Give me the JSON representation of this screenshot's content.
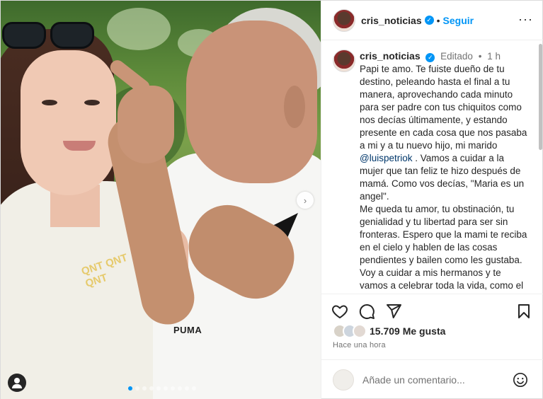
{
  "header": {
    "username": "cris_noticias",
    "separator": "•",
    "follow_label": "Seguir",
    "more_icon": "more-horizontal-icon"
  },
  "caption": {
    "username": "cris_noticias",
    "edited_label": "Editado",
    "separator": "•",
    "time": "1 h",
    "text_1": "Papi te amo. Te fuiste dueño de tu destino, peleando hasta el final a tu manera, aprovechando cada minuto para ser padre con tus chiquitos como nos decías últimamente, y estando presente en cada cosa que nos pasaba a mi y a tu nuevo hijo, mi marido ",
    "mention": "@luispetriok",
    "text_2": " . Vamos a cuidar a la mujer que tan feliz te hizo después de mamá. Como vos decías, \"Maria es un angel\".",
    "text_3": "Me queda tu amor, tu obstinación, tu genialidad y tu libertad para ser sin fronteras. Espero que la mami te reciba en el cielo y hablen de las cosas pendientes y bailen como les gustaba. Voy a cuidar a mis hermanos y te vamos a celebrar toda la vida, como el tipo único y fenomenal que sos. Hoy todo duele, pero mañana celebraremos"
  },
  "actions": {
    "like_icon": "heart-icon",
    "comment_icon": "comment-icon",
    "share_icon": "send-icon",
    "save_icon": "bookmark-icon"
  },
  "likes": {
    "count_label": "15.709 Me gusta"
  },
  "timestamp": "Hace una hora",
  "comment": {
    "placeholder": "Añade un comentario...",
    "emoji_icon": "emoji-icon"
  },
  "photo": {
    "print_text": "QNT QNT QNT",
    "brand_text": "PUMA",
    "carousel_total": 10,
    "carousel_active": 1,
    "next_icon": "chevron-right-icon",
    "tag_icon": "user-tag-icon"
  },
  "colors": {
    "accent": "#0095f6",
    "text": "#262626",
    "muted": "#737373",
    "border": "#efefef"
  }
}
